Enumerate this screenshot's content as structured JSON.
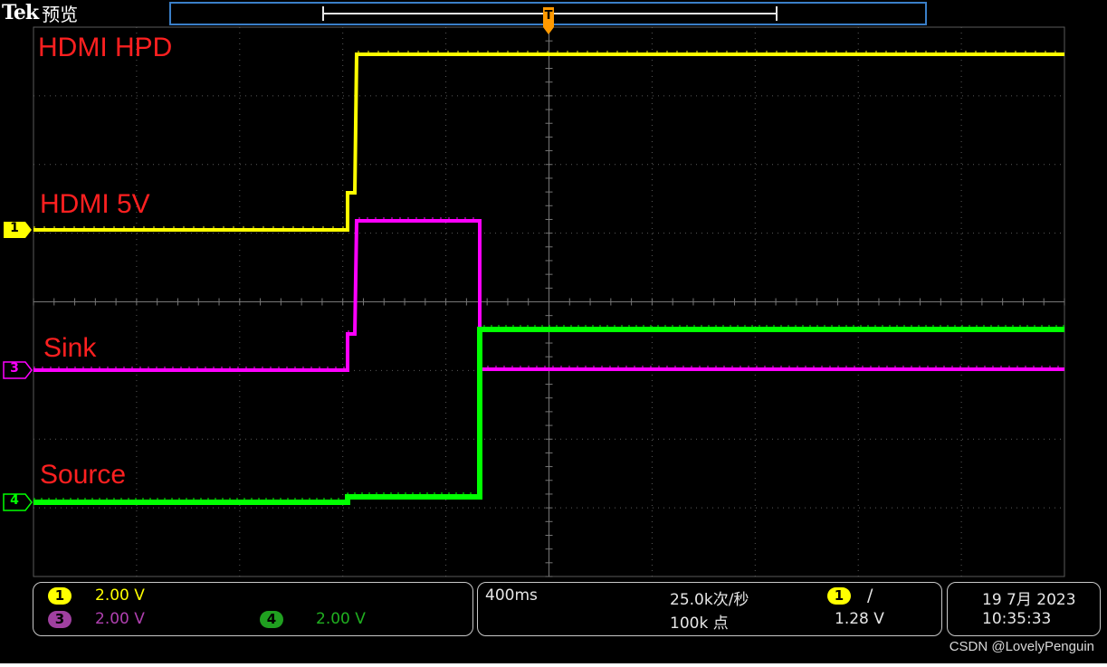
{
  "header": {
    "brand": "Tek",
    "mode": "预览"
  },
  "channels": [
    {
      "number": "1",
      "color": "#ffff00",
      "trace_label": "HDMI HPD",
      "level_label": "HDMI 5V"
    },
    {
      "number": "3",
      "color": "#ff00ff",
      "trace_label": "Sink"
    },
    {
      "number": "4",
      "color": "#00ff00",
      "trace_label": "Source"
    }
  ],
  "trigger_marker": "T",
  "bottom": {
    "ch1_scale": "2.00 V",
    "ch3_scale": "2.00 V",
    "ch4_scale": "2.00 V",
    "timebase": "400ms",
    "sample_rate": "25.0k次/秒",
    "record_length": "100k 点",
    "trigger_channel": "1",
    "trigger_slope": "/",
    "trigger_level": "1.28 V",
    "date": "19 7月 2023",
    "time": "10:35:33"
  },
  "watermark": "CSDN @LovelyPenguin",
  "colors": {
    "ch1": "#ffff00",
    "ch3": "#ff00ff",
    "ch4": "#00ff00",
    "label": "#ff2020",
    "trigger": "#ff9900",
    "background": "#000000"
  }
}
